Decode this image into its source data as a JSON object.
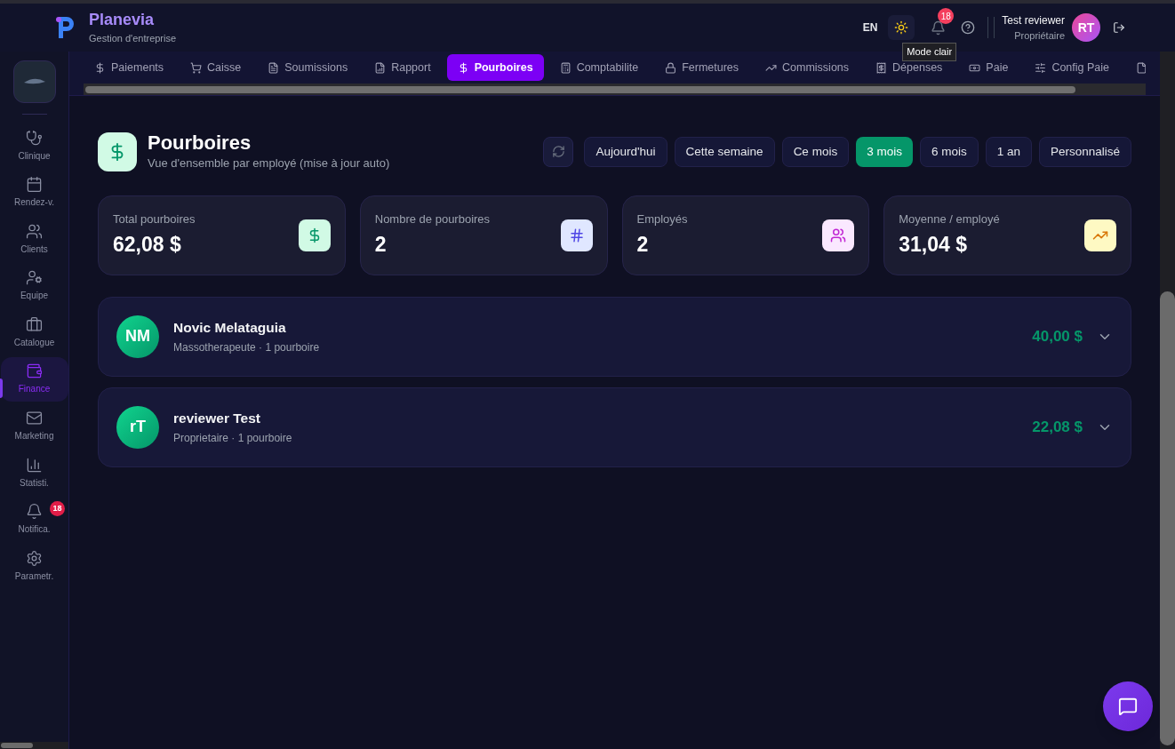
{
  "header": {
    "brand": "Planevia",
    "subtitle": "Gestion d'entreprise",
    "language": "EN",
    "theme_tooltip": "Mode clair",
    "notification_count": "18",
    "user": {
      "name": "Test reviewer",
      "role": "Propriétaire",
      "initials": "RT"
    }
  },
  "sidebar": {
    "items": [
      {
        "label": "Clinique",
        "selected": false
      },
      {
        "label": "Rendez-v.",
        "selected": false
      },
      {
        "label": "Clients",
        "selected": false
      },
      {
        "label": "Equipe",
        "selected": false
      },
      {
        "label": "Catalogue",
        "selected": false
      },
      {
        "label": "Finance",
        "selected": true
      },
      {
        "label": "Marketing",
        "selected": false
      },
      {
        "label": "Statisti.",
        "selected": false
      },
      {
        "label": "Notifica.",
        "selected": false,
        "badge": "18"
      },
      {
        "label": "Parametr.",
        "selected": false
      }
    ]
  },
  "tabs": [
    {
      "label": "Paiements",
      "selected": false
    },
    {
      "label": "Caisse",
      "selected": false
    },
    {
      "label": "Soumissions",
      "selected": false
    },
    {
      "label": "Rapport",
      "selected": false
    },
    {
      "label": "Pourboires",
      "selected": true
    },
    {
      "label": "Comptabilite",
      "selected": false
    },
    {
      "label": "Fermetures",
      "selected": false
    },
    {
      "label": "Commissions",
      "selected": false
    },
    {
      "label": "Dépenses",
      "selected": false
    },
    {
      "label": "Paie",
      "selected": false
    },
    {
      "label": "Config Paie",
      "selected": false
    },
    {
      "selected": false
    }
  ],
  "page": {
    "title": "Pourboires",
    "subtitle": "Vue d'ensemble par employé (mise à jour auto)",
    "periods": [
      {
        "label": "Aujourd'hui",
        "selected": false
      },
      {
        "label": "Cette semaine",
        "selected": false
      },
      {
        "label": "Ce mois",
        "selected": false
      },
      {
        "label": "3 mois",
        "selected": true
      },
      {
        "label": "6 mois",
        "selected": false
      },
      {
        "label": "1 an",
        "selected": false
      },
      {
        "label": "Personnalisé",
        "selected": false
      }
    ],
    "stats": [
      {
        "label": "Total pourboires",
        "value": "62,08 $"
      },
      {
        "label": "Nombre de pourboires",
        "value": "2"
      },
      {
        "label": "Employés",
        "value": "2"
      },
      {
        "label": "Moyenne / employé",
        "value": "31,04 $"
      }
    ],
    "employees": [
      {
        "initials": "NM",
        "name": "Novic Melataguia",
        "detail": "Massotherapeute · 1 pourboire",
        "amount": "40,00 $"
      },
      {
        "initials": "rT",
        "name": "reviewer Test",
        "detail": "Proprietaire · 1 pourboire",
        "amount": "22,08 $"
      }
    ]
  }
}
